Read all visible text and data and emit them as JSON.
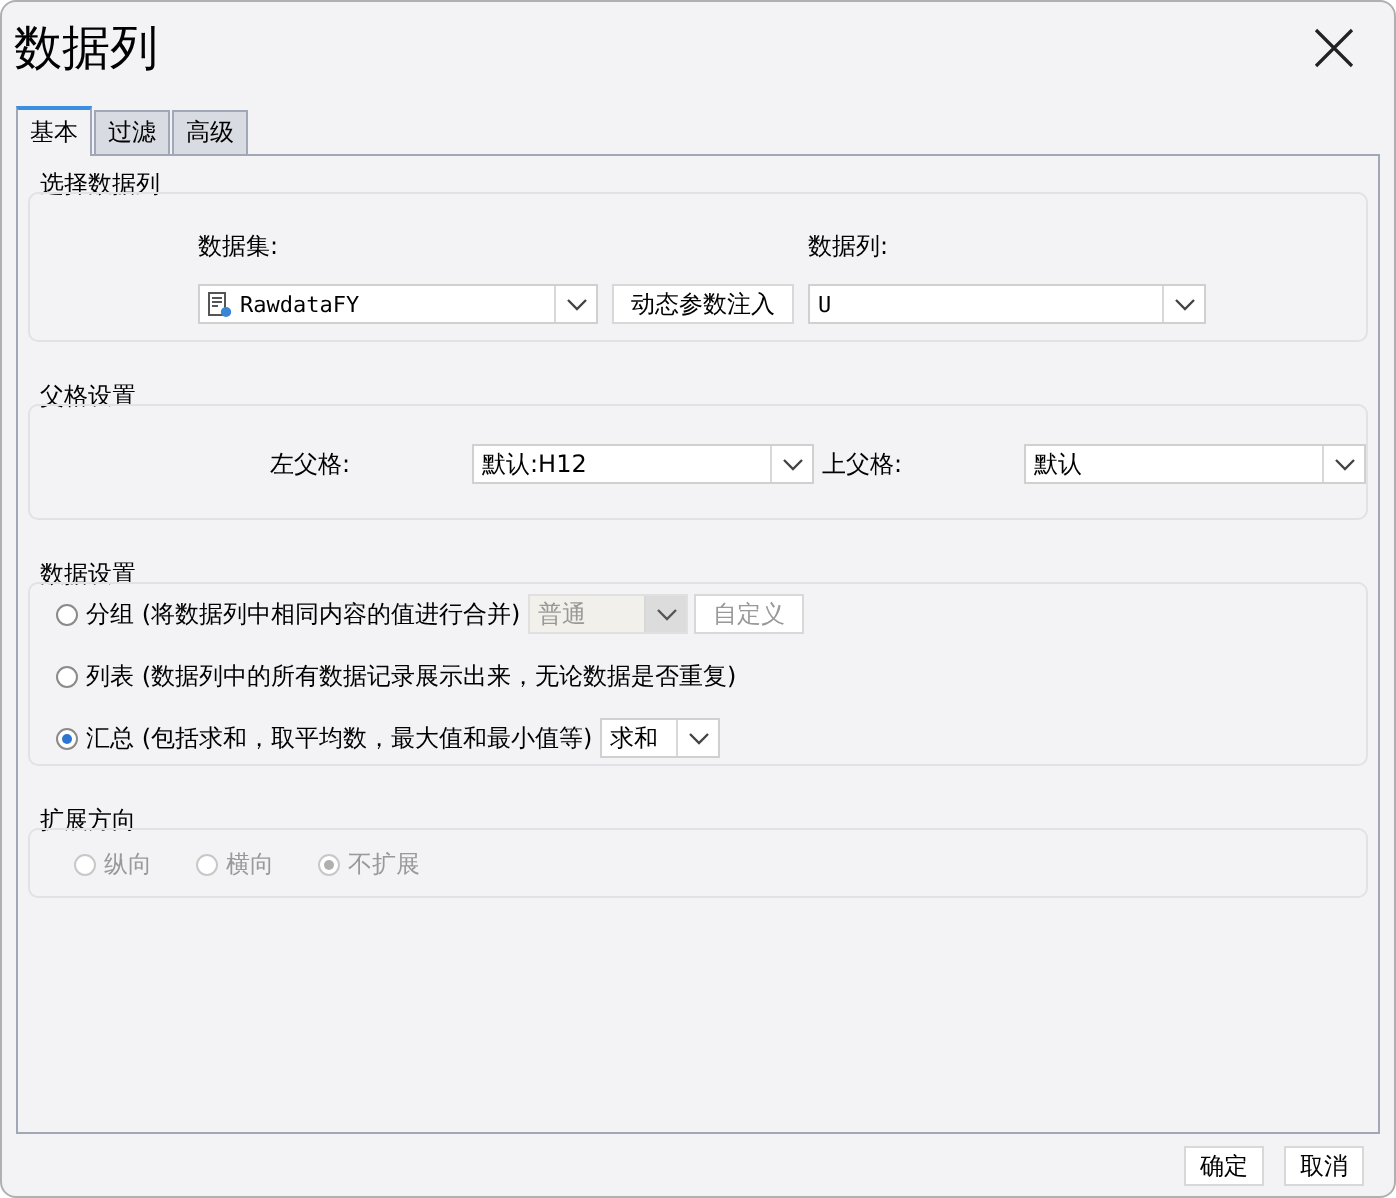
{
  "window": {
    "title": "数据列"
  },
  "tabs": [
    {
      "label": "基本",
      "selected": true
    },
    {
      "label": "过滤",
      "selected": false
    },
    {
      "label": "高级",
      "selected": false
    }
  ],
  "select_column": {
    "legend": "选择数据列",
    "dataset_label": "数据集:",
    "dataset_value": "RawdataFY",
    "inject_button": "动态参数注入",
    "column_label": "数据列:",
    "column_value": "U"
  },
  "parent_cells": {
    "legend": "父格设置",
    "left_label": "左父格:",
    "left_value": "默认:H12",
    "top_label": "上父格:",
    "top_value": "默认"
  },
  "data_settings": {
    "legend": "数据设置",
    "options": [
      {
        "kind": "group",
        "label": "分组 (将数据列中相同内容的值进行合并)",
        "selected": false,
        "select_value": "普通",
        "select_disabled": true,
        "button": "自定义",
        "button_disabled": true
      },
      {
        "kind": "list",
        "label": "列表 (数据列中的所有数据记录展示出来，无论数据是否重复)",
        "selected": false
      },
      {
        "kind": "summary",
        "label": "汇总 (包括求和，取平均数，最大值和最小值等)",
        "selected": true,
        "select_value": "求和"
      }
    ]
  },
  "expand_direction": {
    "legend": "扩展方向",
    "disabled": true,
    "options": [
      {
        "label": "纵向",
        "selected": false
      },
      {
        "label": "横向",
        "selected": false
      },
      {
        "label": "不扩展",
        "selected": true
      }
    ]
  },
  "buttons": [
    {
      "label": "确定"
    },
    {
      "label": "取消"
    }
  ]
}
